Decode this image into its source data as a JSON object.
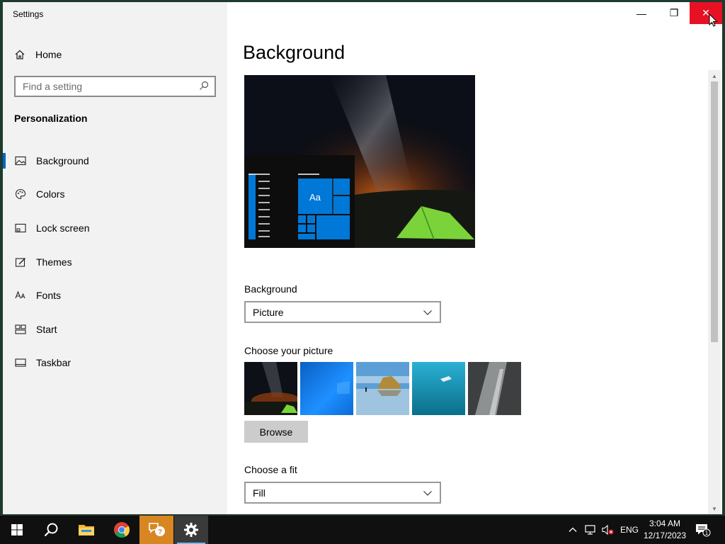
{
  "window": {
    "title": "Settings",
    "minimize_glyph": "—",
    "maximize_glyph": "❐",
    "close_glyph": "✕"
  },
  "sidebar": {
    "home_label": "Home",
    "search_placeholder": "Find a setting",
    "section_title": "Personalization",
    "items": [
      {
        "label": "Background",
        "icon": "picture-icon",
        "active": true
      },
      {
        "label": "Colors",
        "icon": "palette-icon"
      },
      {
        "label": "Lock screen",
        "icon": "lock-screen-icon"
      },
      {
        "label": "Themes",
        "icon": "brush-icon"
      },
      {
        "label": "Fonts",
        "icon": "font-icon"
      },
      {
        "label": "Start",
        "icon": "start-icon"
      },
      {
        "label": "Taskbar",
        "icon": "taskbar-icon"
      }
    ]
  },
  "main": {
    "page_title": "Background",
    "preview_tile_label": "Aa",
    "background_label": "Background",
    "background_value": "Picture",
    "choose_picture_label": "Choose your picture",
    "browse_label": "Browse",
    "choose_fit_label": "Choose a fit",
    "fit_value": "Fill"
  },
  "taskbar": {
    "language": "ENG",
    "time": "3:04 AM",
    "date": "12/17/2023",
    "notification_count": "1",
    "apps": [
      "start-icon",
      "search-icon",
      "file-explorer-icon",
      "chrome-icon",
      "get-help-icon",
      "settings-icon"
    ]
  },
  "colors": {
    "accent": "#0067c0",
    "close_red": "#e81123",
    "tile_blue": "#0078d7"
  }
}
